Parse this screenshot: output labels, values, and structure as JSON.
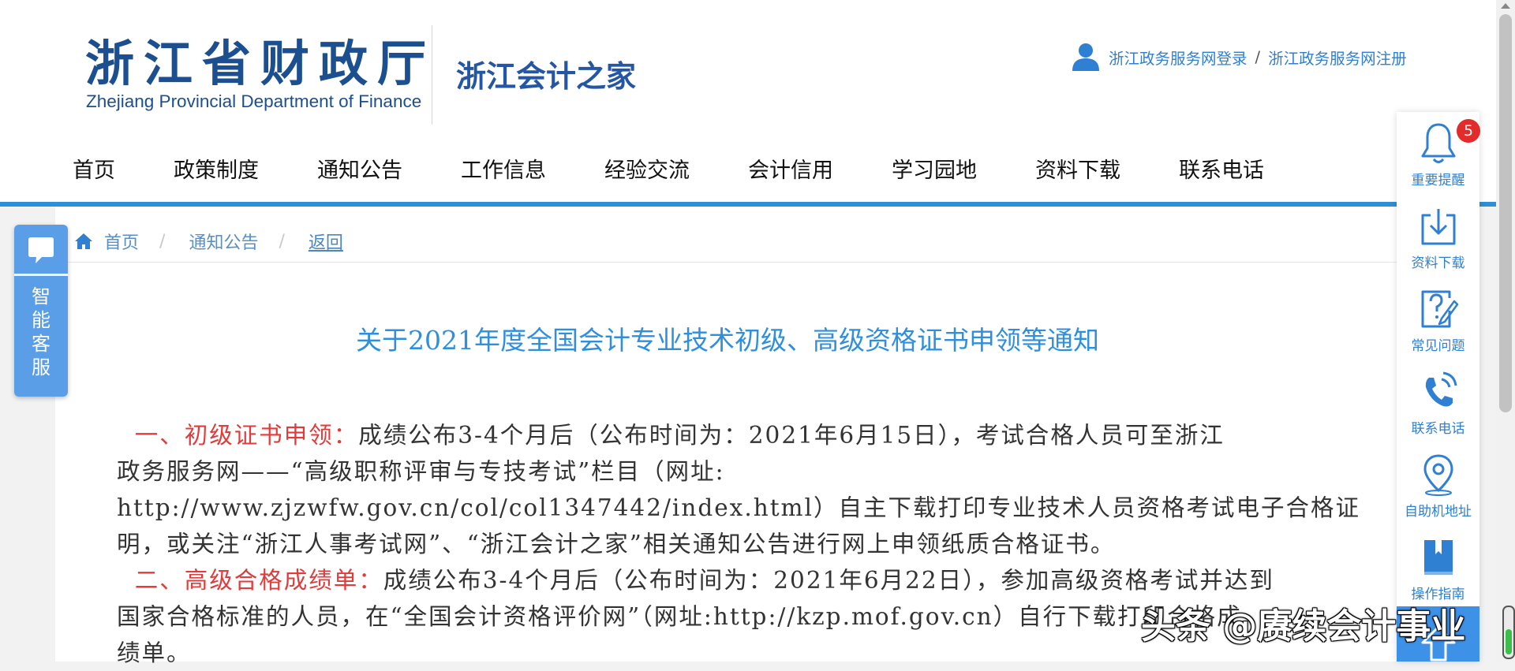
{
  "header": {
    "logo_cn": "浙江省财政厅",
    "logo_en": "Zhejiang Provincial Department of Finance",
    "subtitle": "浙江会计之家",
    "login_label": "浙江政务服务网登录",
    "link_separator": "/",
    "register_label": "浙江政务服务网注册"
  },
  "nav": {
    "items": [
      {
        "label": "首页"
      },
      {
        "label": "政策制度"
      },
      {
        "label": "通知公告"
      },
      {
        "label": "工作信息"
      },
      {
        "label": "经验交流"
      },
      {
        "label": "会计信用"
      },
      {
        "label": "学习园地"
      },
      {
        "label": "资料下载"
      },
      {
        "label": "联系电话"
      }
    ]
  },
  "breadcrumb": {
    "home": "首页",
    "separator": "/",
    "section": "通知公告",
    "back": "返回"
  },
  "article": {
    "title": "关于2021年度全国会计专业技术初级、高级资格证书申领等通知",
    "p1": {
      "heading": "一、初级证书申领：",
      "line1": "成绩公布3-4个月后（公布时间为：2021年6月15日），考试合格人员可至浙江",
      "line2": "政务服务网——“高级职称评审与专技考试”栏目（网址:",
      "line3": "http://www.zjzwfw.gov.cn/col/col1347442/index.html）自主下载打印专业技术人员资格考试电子合格证",
      "line4": "明，或关注“浙江人事考试网”、“浙江会计之家”相关通知公告进行网上申领纸质合格证书。"
    },
    "p2": {
      "heading": "二、高级合格成绩单：",
      "line1": "成绩公布3-4个月后（公布时间为：2021年6月22日），参加高级资格考试并达到",
      "line2": "国家合格标准的人员，在“全国会计资格评价网”（网址:http://kzp.mof.gov.cn）自行下载打印合格成",
      "line3": "绩单。"
    }
  },
  "service": {
    "label_chars": [
      "智",
      "能",
      "客",
      "服"
    ]
  },
  "sidebar": {
    "items": [
      {
        "label": "重要提醒",
        "icon": "bell-icon",
        "badge": "5"
      },
      {
        "label": "资料下载",
        "icon": "download-icon"
      },
      {
        "label": "常见问题",
        "icon": "question-icon"
      },
      {
        "label": "联系电话",
        "icon": "phone-icon"
      },
      {
        "label": "自助机地址",
        "icon": "location-pin-icon"
      },
      {
        "label": "操作指南",
        "icon": "bookmark-icon"
      }
    ]
  },
  "watermark": "头条 @赓续会计事业",
  "colors": {
    "brand": "#1c4f8f",
    "accent": "#2d8fd5",
    "link": "#2f7fd2",
    "title": "#2f8fdc",
    "highlight": "#e23b3b",
    "service_tab": "#5b9ee8"
  }
}
